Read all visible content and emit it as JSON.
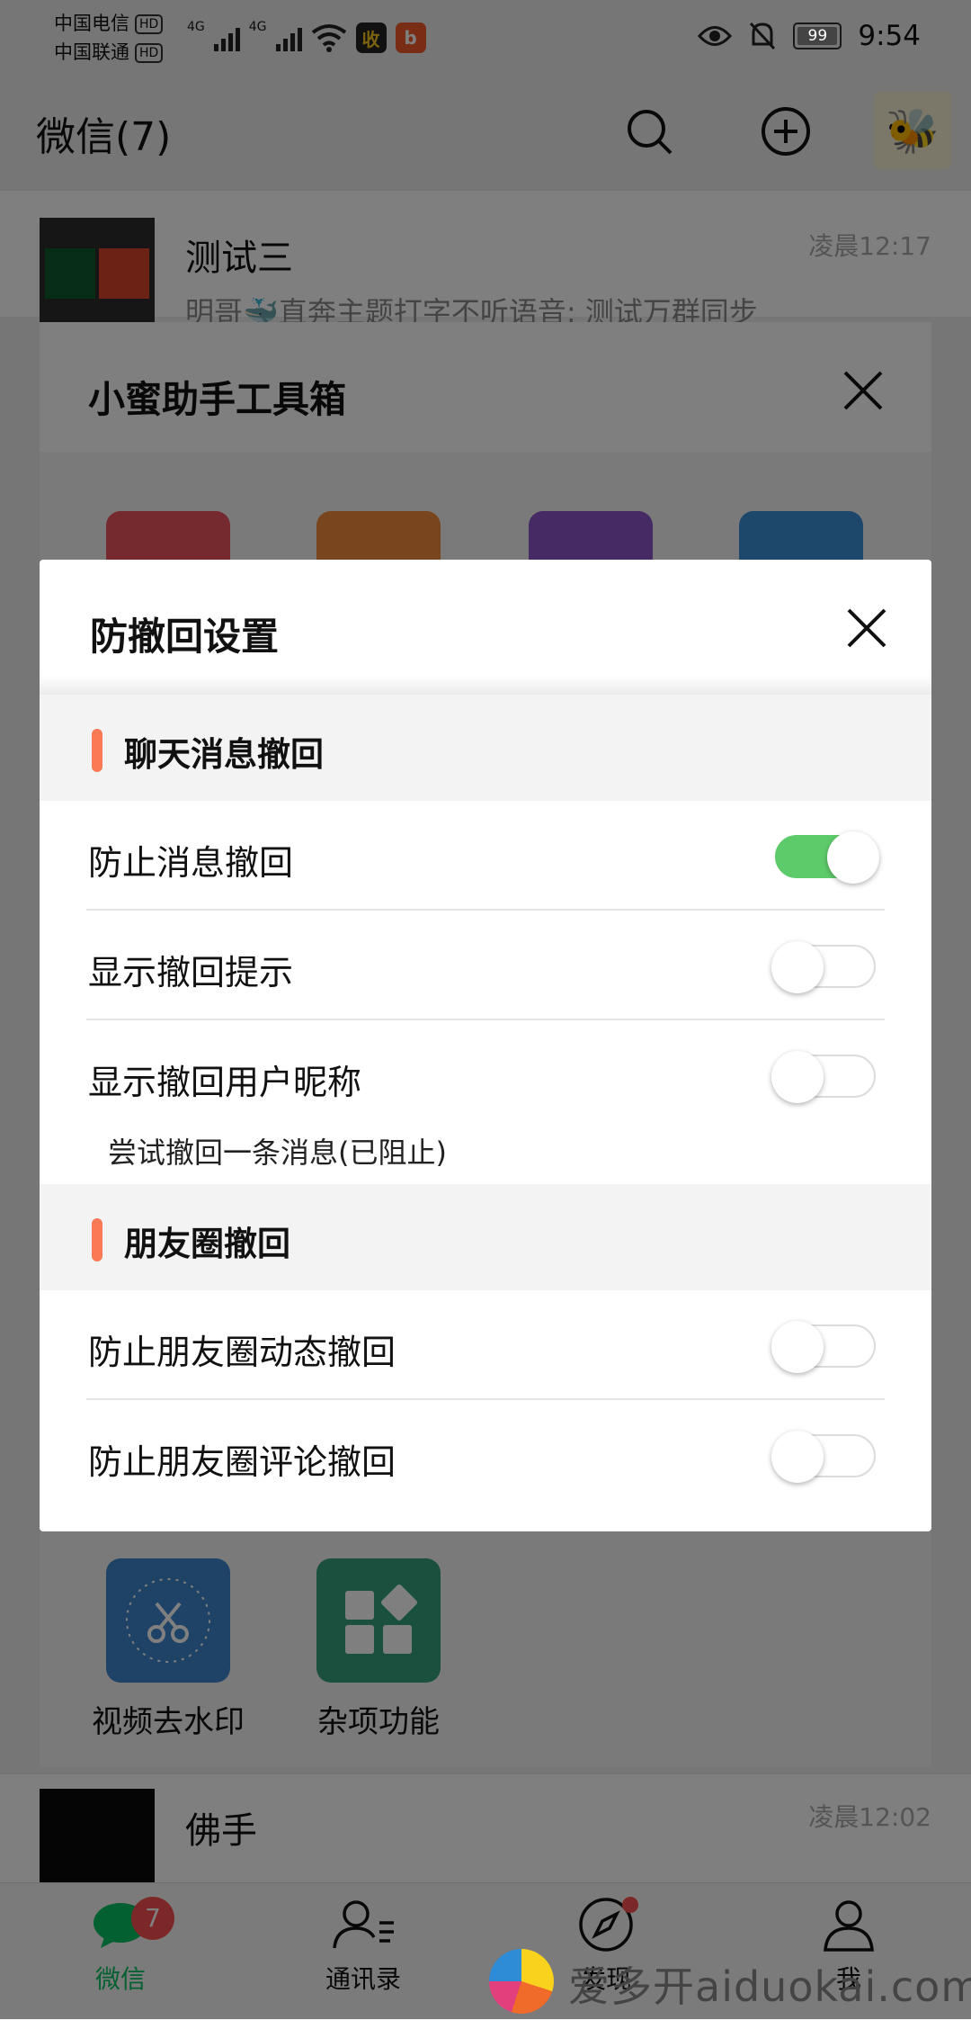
{
  "status_bar": {
    "carrier1": "中国电信",
    "carrier2": "中国联通",
    "hd": "HD",
    "net1": "4G",
    "net2": "4G",
    "app1": "收",
    "app2": "b",
    "battery": "99",
    "time": "9:54"
  },
  "header": {
    "title": "微信(7)"
  },
  "chats": [
    {
      "name": "测试三",
      "message": "明哥🐳直奔主题打字不听语音: 测试万群同步",
      "time": "凌晨12:17"
    },
    {
      "name": "佛手",
      "time": "凌晨12:02"
    }
  ],
  "toolbox": {
    "title": "小蜜助手工具箱",
    "tools": [
      {
        "label": "视频去水印",
        "icon": "scissors-icon"
      },
      {
        "label": "杂项功能",
        "icon": "grid-diamond-icon"
      }
    ]
  },
  "dialog": {
    "title": "防撤回设置",
    "sections": [
      {
        "label": "聊天消息撤回",
        "rows": [
          {
            "label": "防止消息撤回",
            "on": true
          },
          {
            "label": "显示撤回提示",
            "on": false
          },
          {
            "label": "显示撤回用户昵称",
            "on": false
          }
        ],
        "hint": "尝试撤回一条消息(已阻止)"
      },
      {
        "label": "朋友圈撤回",
        "rows": [
          {
            "label": "防止朋友圈动态撤回",
            "on": false
          },
          {
            "label": "防止朋友圈评论撤回",
            "on": false
          }
        ]
      }
    ]
  },
  "tabbar": {
    "tabs": [
      {
        "label": "微信",
        "badge": "7"
      },
      {
        "label": "通讯录"
      },
      {
        "label": "发现"
      },
      {
        "label": "我"
      }
    ]
  },
  "watermark": "爱多开aiduokai.com",
  "colors": {
    "accent": "#07c160",
    "toggle_on": "#5ecb6b",
    "section_bar": "#fa7a55",
    "badge": "#fa5151"
  }
}
